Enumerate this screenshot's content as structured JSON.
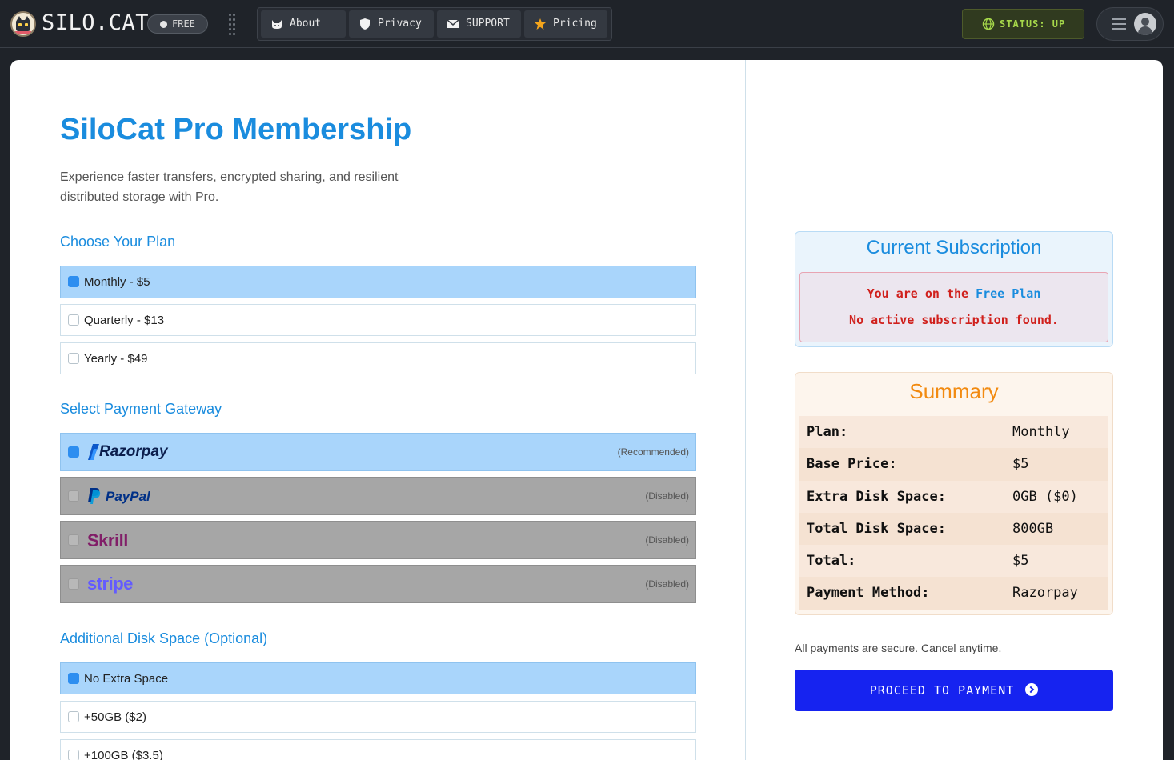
{
  "topbar": {
    "brand": "SILO.CAT",
    "tier_badge": "FREE",
    "nav": [
      {
        "label": "About",
        "icon": "cat-icon"
      },
      {
        "label": "Privacy",
        "icon": "shield-icon"
      },
      {
        "label": "SUPPORT",
        "icon": "mail-icon"
      },
      {
        "label": "Pricing",
        "icon": "star-icon"
      }
    ],
    "status": "STATUS: UP"
  },
  "colors": {
    "accent": "#1a8cde",
    "selected": "#a9d5fb",
    "disabled": "#a6a6a6",
    "summary_title": "#f28a10",
    "error_text": "#d0201c",
    "primary_button": "#1623f0",
    "status_text": "#a6d84a"
  },
  "main": {
    "title": "SiloCat Pro Membership",
    "subtitle": "Experience faster transfers, encrypted sharing, and resilient distributed storage with Pro.",
    "plan_section": "Choose Your Plan",
    "plans": [
      {
        "label": "Monthly - $5",
        "selected": true
      },
      {
        "label": "Quarterly - $13",
        "selected": false
      },
      {
        "label": "Yearly - $49",
        "selected": false
      }
    ],
    "gateway_section": "Select Payment Gateway",
    "gateways": [
      {
        "name": "Razorpay",
        "note": "(Recommended)",
        "selected": true,
        "disabled": false
      },
      {
        "name": "PayPal",
        "note": "(Disabled)",
        "selected": false,
        "disabled": true
      },
      {
        "name": "Skrill",
        "note": "(Disabled)",
        "selected": false,
        "disabled": true
      },
      {
        "name": "stripe",
        "note": "(Disabled)",
        "selected": false,
        "disabled": true
      }
    ],
    "disk_section": "Additional Disk Space (Optional)",
    "disk_options": [
      {
        "label": "No Extra Space",
        "selected": true
      },
      {
        "label": "+50GB ($2)",
        "selected": false
      },
      {
        "label": "+100GB ($3.5)",
        "selected": false
      }
    ]
  },
  "subscription": {
    "title": "Current Subscription",
    "line1_prefix": "You are on the",
    "line1_plan": "Free Plan",
    "line2": "No active subscription found."
  },
  "summary": {
    "title": "Summary",
    "rows": [
      {
        "key": "Plan:",
        "value": "Monthly"
      },
      {
        "key": "Base Price:",
        "value": "$5"
      },
      {
        "key": "Extra Disk Space:",
        "value": "0GB ($0)"
      },
      {
        "key": "Total Disk Space:",
        "value": "800GB"
      },
      {
        "key": "Total:",
        "value": "$5"
      },
      {
        "key": "Payment Method:",
        "value": "Razorpay"
      }
    ]
  },
  "checkout": {
    "secure_note": "All payments are secure. Cancel anytime.",
    "button_label": "PROCEED TO PAYMENT"
  }
}
